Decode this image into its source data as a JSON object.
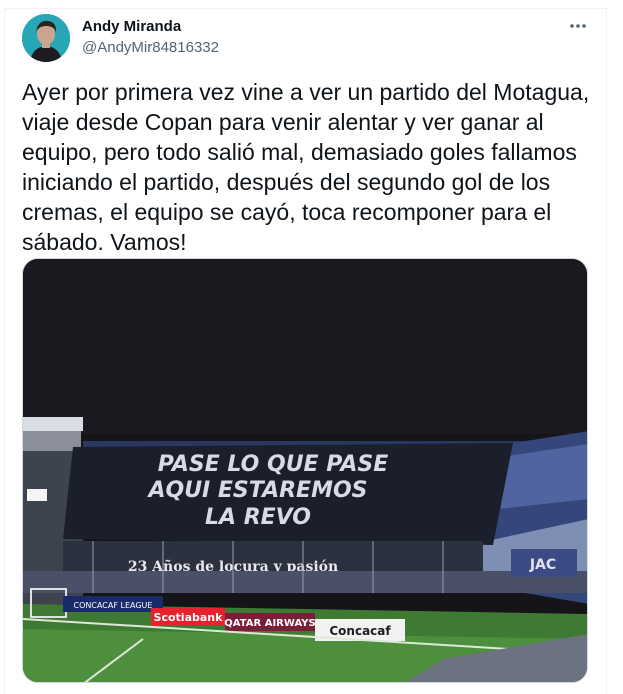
{
  "tweet": {
    "author_name": "Andy Miranda",
    "author_handle": "@AndyMir84816332",
    "more_icon": "more-horizontal-icon",
    "lines": [
      "Ayer por primera vez vine a ver un partido del Motagua,",
      "viaje desde Copan para venir alentar y ver ganar al",
      "equipo, pero todo salió mal, demasiado goles fallamos",
      "iniciando el partido, después del segundo gol de los",
      "cremas, el equipo se cayó, toca recomponer para el",
      "sábado. Vamos!"
    ]
  },
  "photo": {
    "banner_line1": "PASE LO QUE PASE",
    "banner_line2": "AQUI ESTAREMOS",
    "banner_line3": "LA REVO",
    "stand_sign": "23 Años de locura y pasión",
    "board_concacaf_league": "CONCACAF LEAGUE",
    "board_scotiabank": "Scotiabank",
    "board_qatar": "QATAR AIRWAYS",
    "board_concacaf": "Concacaf",
    "sign_right": "JAC"
  }
}
